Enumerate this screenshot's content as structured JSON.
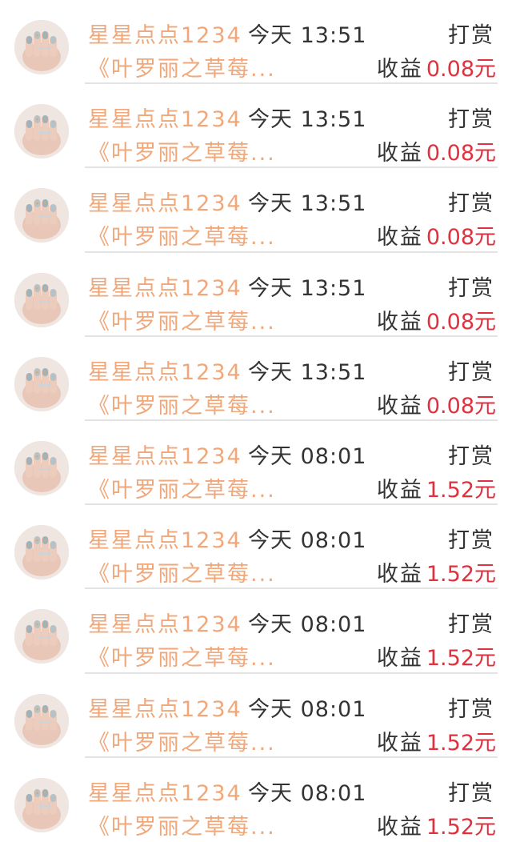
{
  "rows": [
    {
      "user": "星星点点1234",
      "time": "今天 13:51",
      "action": "打赏",
      "book": "《叶罗丽之草莓...",
      "earn_label": "收益",
      "amount": "0.08元"
    },
    {
      "user": "星星点点1234",
      "time": "今天 13:51",
      "action": "打赏",
      "book": "《叶罗丽之草莓...",
      "earn_label": "收益",
      "amount": "0.08元"
    },
    {
      "user": "星星点点1234",
      "time": "今天 13:51",
      "action": "打赏",
      "book": "《叶罗丽之草莓...",
      "earn_label": "收益",
      "amount": "0.08元"
    },
    {
      "user": "星星点点1234",
      "time": "今天 13:51",
      "action": "打赏",
      "book": "《叶罗丽之草莓...",
      "earn_label": "收益",
      "amount": "0.08元"
    },
    {
      "user": "星星点点1234",
      "time": "今天 13:51",
      "action": "打赏",
      "book": "《叶罗丽之草莓...",
      "earn_label": "收益",
      "amount": "0.08元"
    },
    {
      "user": "星星点点1234",
      "time": "今天 08:01",
      "action": "打赏",
      "book": "《叶罗丽之草莓...",
      "earn_label": "收益",
      "amount": "1.52元"
    },
    {
      "user": "星星点点1234",
      "time": "今天 08:01",
      "action": "打赏",
      "book": "《叶罗丽之草莓...",
      "earn_label": "收益",
      "amount": "1.52元"
    },
    {
      "user": "星星点点1234",
      "time": "今天 08:01",
      "action": "打赏",
      "book": "《叶罗丽之草莓...",
      "earn_label": "收益",
      "amount": "1.52元"
    },
    {
      "user": "星星点点1234",
      "time": "今天 08:01",
      "action": "打赏",
      "book": "《叶罗丽之草莓...",
      "earn_label": "收益",
      "amount": "1.52元"
    },
    {
      "user": "星星点点1234",
      "time": "今天 08:01",
      "action": "打赏",
      "book": "《叶罗丽之草莓...",
      "earn_label": "收益",
      "amount": "1.52元"
    }
  ],
  "colors": {
    "accent_orange": "#f0a77a",
    "amount_red": "#e0313f",
    "text_dark": "#333333",
    "divider": "#e3e3e3"
  },
  "icons": {
    "avatar": "avatar-manicured-hand-photo"
  }
}
